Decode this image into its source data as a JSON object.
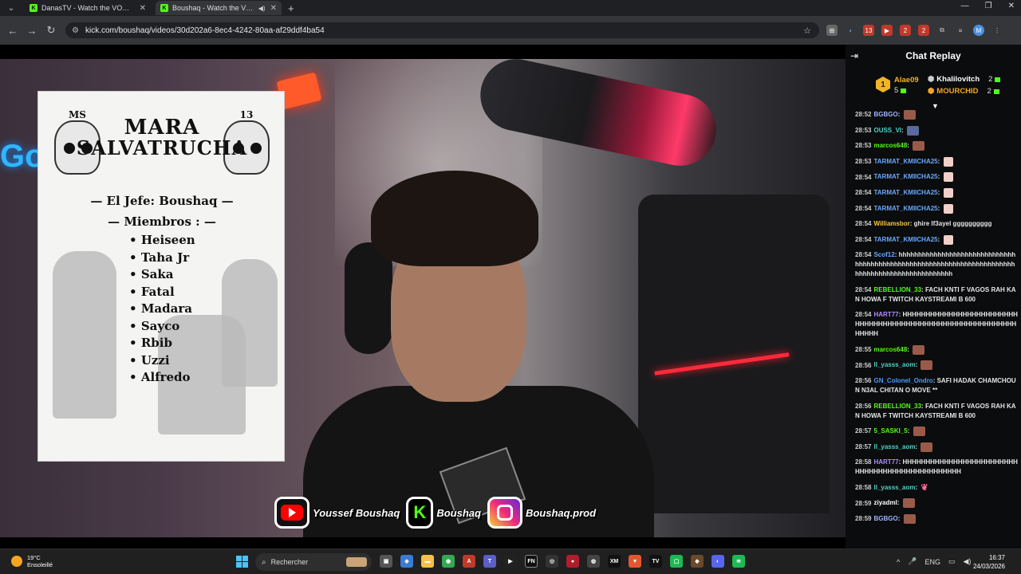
{
  "browser": {
    "tabs": [
      {
        "title": "DanasTV - Watch the VOD on Ki"
      },
      {
        "title": "Boushaq - Watch the VOD o"
      }
    ],
    "new_tab": "+",
    "url": "kick.com/boushaq/videos/30d202a6-8ec4-4242-80aa-af29ddf4ba54",
    "profile_initial": "M",
    "extension_badges": [
      "13",
      "2",
      "2"
    ]
  },
  "video": {
    "poster": {
      "title_line1": "MARA",
      "title_line2": "SALVATRUCHA",
      "skull_left": "MS",
      "skull_right": "13",
      "chief": "El Jefe: Boushaq",
      "members_title": "Miembros :",
      "members": [
        "Heiseen",
        "Taha Jr",
        "Saka",
        "Fatal",
        "Madara",
        "Sayco",
        "Rbib",
        "Uzzi",
        "Alfredo"
      ]
    },
    "socials": [
      {
        "platform": "youtube",
        "icon": "youtube-icon",
        "label": "Youssef Boushaq"
      },
      {
        "platform": "kick",
        "icon": "kick-icon",
        "label": "Boushaq",
        "glyph": "K"
      },
      {
        "platform": "instagram",
        "icon": "instagram-icon",
        "label": "Boushaq.prod"
      }
    ]
  },
  "chat": {
    "title": "Chat Replay",
    "leaders": [
      {
        "rank": "1",
        "name": "Alae09",
        "count": "5",
        "color": "#f0b429"
      },
      {
        "name": "Khalilovitch",
        "count": "2",
        "color": "#ffffff"
      },
      {
        "name": "MOURCHID",
        "count": "2",
        "color": "#f5a623"
      }
    ],
    "messages": [
      {
        "time": "28:52",
        "user": "BGBGO",
        "color": "#9fb4ff",
        "text": "",
        "emote": "emote"
      },
      {
        "time": "28:53",
        "user": "OUSS_VI",
        "color": "#4fd1c5",
        "text": "",
        "emote": "avatar"
      },
      {
        "time": "28:53",
        "user": "marcos648",
        "color": "#53fc18",
        "text": "",
        "emote": "emote"
      },
      {
        "time": "28:53",
        "user": "TARMAT_KMIICHA25",
        "color": "#6aa8ff",
        "text": "",
        "emote": "girl"
      },
      {
        "time": "28:54",
        "user": "TARMAT_KMIICHA25",
        "color": "#6aa8ff",
        "text": "",
        "emote": "girl"
      },
      {
        "time": "28:54",
        "user": "TARMAT_KMIICHA25",
        "color": "#6aa8ff",
        "text": "",
        "emote": "girl"
      },
      {
        "time": "28:54",
        "user": "TARMAT_KMIICHA25",
        "color": "#6aa8ff",
        "text": "",
        "emote": "girl"
      },
      {
        "time": "28:54",
        "user": "Williamsbor",
        "color": "#f5c542",
        "text": "ghire lf3ayel gggggggggg",
        "emote": ""
      },
      {
        "time": "28:54",
        "user": "TARMAT_KMIICHA25",
        "color": "#6aa8ff",
        "text": "",
        "emote": "girl"
      },
      {
        "time": "28:54",
        "user": "Scof12",
        "color": "#6aa8ff",
        "text": "hhhhhhhhhhhhhhhhhhhhhhhhhhhhhhhhhhhhhhhhhhhhhhhhhhhhhhhhhhhhhhhhhhhhhhhhhhhhhhhhhhhhhhhhhhhhhhhh",
        "emote": ""
      },
      {
        "time": "28:54",
        "user": "REBELLION_33",
        "color": "#53fc18",
        "text": "FACH KNTI F VAGOS RAH KAN HOWA F TWITCH KAYSTREAMI B 600",
        "emote": ""
      },
      {
        "time": "28:54",
        "user": "HART77",
        "color": "#b18cff",
        "text": "HHHHHHHHHHHHHHHHHHHHHHHHHHHHHHHHHHHHHHHHHHHHHHHHHHHHHHHHHHHHHHHHH",
        "emote": ""
      },
      {
        "time": "28:55",
        "user": "marcos648",
        "color": "#53fc18",
        "text": "",
        "emote": "emote"
      },
      {
        "time": "28:56",
        "user": "ll_yasss_aom",
        "color": "#4fd1c5",
        "text": "",
        "emote": "emote"
      },
      {
        "time": "28:56",
        "user": "GN_Colonel_Ondro",
        "color": "#4a9dff",
        "text": "SAFI HADAK CHAMCHOUN N3AL CHITAN O MOVE **",
        "emote": ""
      },
      {
        "time": "28:56",
        "user": "REBELLION_33",
        "color": "#53fc18",
        "text": "FACH KNTI F VAGOS RAH KAN HOWA F TWITCH KAYSTREAMI B 600",
        "emote": ""
      },
      {
        "time": "28:57",
        "user": "5_SASKI_5",
        "color": "#53fc18",
        "text": "",
        "emote": "emote"
      },
      {
        "time": "28:57",
        "user": "ll_yasss_aom",
        "color": "#4fd1c5",
        "text": "",
        "emote": "emote"
      },
      {
        "time": "28:58",
        "user": "HART77",
        "color": "#b18cff",
        "text": "HHHHHHHHHHHHHHHHHHHHHHHHHHHHHHHHHHHHHHHHHHHHHHHH",
        "emote": ""
      },
      {
        "time": "28:58",
        "user": "ll_yasss_aom",
        "color": "#4fd1c5",
        "text": "",
        "emote": "pink"
      },
      {
        "time": "28:59",
        "user": "ziyadml",
        "color": "#ffffff",
        "text": "",
        "emote": "emote"
      },
      {
        "time": "28:59",
        "user": "BGBGO",
        "color": "#9fb4ff",
        "text": "",
        "emote": "emote"
      }
    ]
  },
  "taskbar": {
    "weather_temp": "19°C",
    "weather_desc": "Ensoleillé",
    "search_placeholder": "Rechercher",
    "language": "ENG",
    "time": "16:37",
    "date": "24/03/2026"
  }
}
